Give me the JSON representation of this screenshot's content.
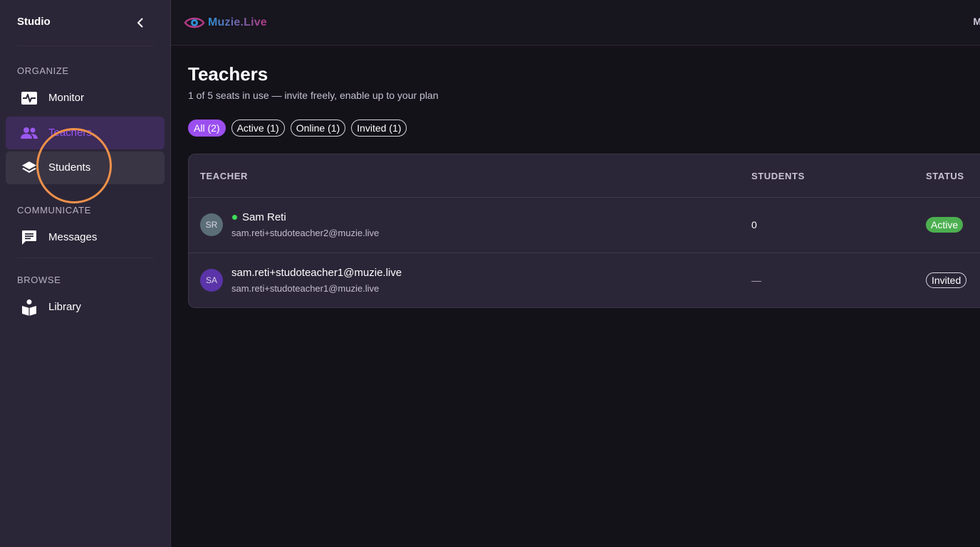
{
  "sidebar": {
    "title": "Studio",
    "sections": [
      {
        "label": "ORGANIZE"
      },
      {
        "label": "COMMUNICATE"
      },
      {
        "label": "BROWSE"
      }
    ],
    "items": [
      {
        "label": "Monitor",
        "icon": "monitor-heartbeat-icon"
      },
      {
        "label": "Teachers",
        "icon": "people-icon"
      },
      {
        "label": "Students",
        "icon": "layers-icon"
      },
      {
        "label": "Messages",
        "icon": "chat-icon"
      },
      {
        "label": "Library",
        "icon": "reader-book-icon"
      }
    ],
    "active_item": "Teachers",
    "hovered_item": "Students"
  },
  "topbar": {
    "brand": "Muzie.Live",
    "edge_text": "M"
  },
  "page": {
    "title": "Teachers",
    "subtitle": "1 of 5 seats in use — invite freely, enable up to your plan"
  },
  "filters": [
    {
      "label": "All (2)",
      "selected": true
    },
    {
      "label": "Active (1)",
      "selected": false
    },
    {
      "label": "Online (1)",
      "selected": false
    },
    {
      "label": "Invited (1)",
      "selected": false
    }
  ],
  "table": {
    "columns": [
      "TEACHER",
      "STUDENTS",
      "STATUS"
    ],
    "rows": [
      {
        "initials": "SR",
        "name": "Sam Reti",
        "email": "sam.reti+studoteacher2@muzie.live",
        "students": "0",
        "status": "Active",
        "online": true
      },
      {
        "initials": "SA",
        "name": "sam.reti+studoteacher1@muzie.live",
        "email": "sam.reti+studoteacher1@muzie.live",
        "students": "—",
        "status": "Invited",
        "online": false
      }
    ]
  },
  "colors": {
    "accent": "#9b4ff0",
    "active_status": "#4caf50",
    "online": "#3ddc57",
    "cursor_highlight": "#f0914a"
  }
}
